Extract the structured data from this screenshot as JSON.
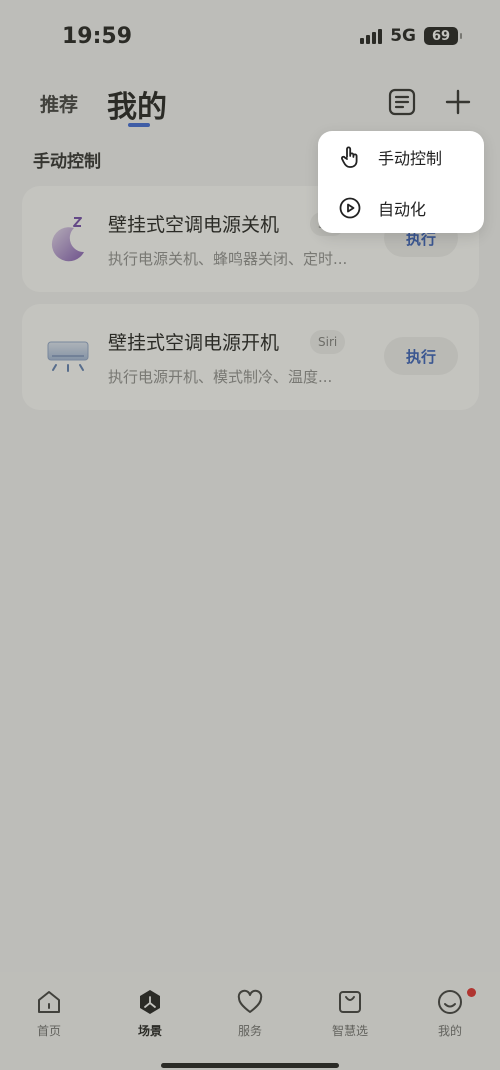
{
  "status_bar": {
    "time": "19:59",
    "network": "5G",
    "battery": "69"
  },
  "header": {
    "tab_recommend": "推荐",
    "tab_mine": "我的",
    "list_icon": "list-icon",
    "add_icon": "plus-icon"
  },
  "section": {
    "title": "手动控制"
  },
  "cards": [
    {
      "title": "壁挂式空调电源关机",
      "badge": "Siri",
      "description": "执行电源关机、蜂鸣器关闭、定时...",
      "button": "执行",
      "icon": "moon-sleep-icon"
    },
    {
      "title": "壁挂式空调电源开机",
      "badge": "Siri",
      "description": "执行电源开机、模式制冷、温度...",
      "button": "执行",
      "icon": "air-conditioner-icon"
    }
  ],
  "popup_menu": {
    "items": [
      {
        "label": "手动控制",
        "icon": "hand-pointer-icon"
      },
      {
        "label": "自动化",
        "icon": "play-circle-icon"
      }
    ]
  },
  "bottom_nav": {
    "items": [
      {
        "label": "首页",
        "icon": "home-icon"
      },
      {
        "label": "场景",
        "icon": "scene-icon",
        "active": true
      },
      {
        "label": "服务",
        "icon": "heart-icon"
      },
      {
        "label": "智慧选",
        "icon": "shopping-bag-icon"
      },
      {
        "label": "我的",
        "icon": "smiley-icon",
        "has_notification": true
      }
    ]
  },
  "colors": {
    "accent": "#2f5fd8",
    "button_text": "#2a55b8",
    "notification": "#e02020"
  }
}
